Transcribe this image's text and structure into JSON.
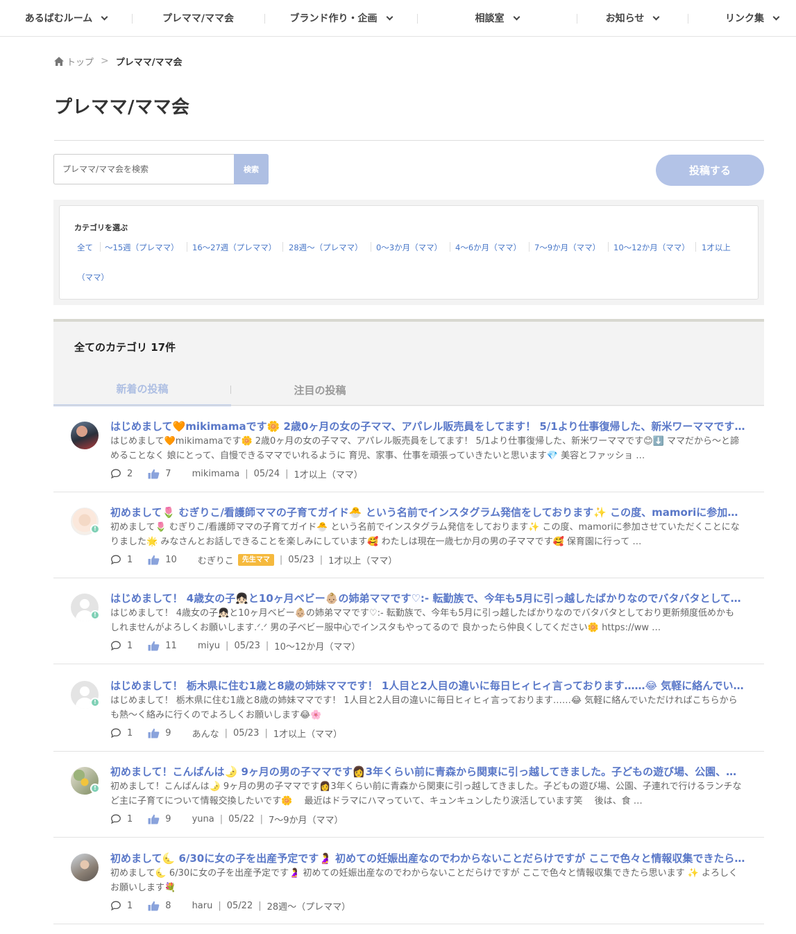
{
  "nav": [
    {
      "label": "あるばむルーム",
      "dropdown": true
    },
    {
      "label": "プレママ/ママ会",
      "dropdown": false
    },
    {
      "label": "ブランド作り・企画",
      "dropdown": true
    },
    {
      "label": "相談室",
      "dropdown": true
    },
    {
      "label": "お知らせ",
      "dropdown": true
    },
    {
      "label": "リンク集",
      "dropdown": true
    }
  ],
  "breadcrumb": {
    "home": "トップ",
    "separator": ">",
    "current": "プレママ/ママ会"
  },
  "page_title": "プレママ/ママ会",
  "search": {
    "placeholder": "プレママ/ママ会を検索",
    "button": "検索"
  },
  "post_button": "投稿する",
  "categories": {
    "heading": "カテゴリを選ぶ",
    "items": [
      "全て",
      "〜15週（プレママ）",
      "16〜27週（プレママ）",
      "28週〜（プレママ）",
      "0〜3か月（ママ）",
      "4〜6か月（ママ）",
      "7〜9か月（ママ）",
      "10〜12か月（ママ）",
      "1才以上",
      "（ママ）"
    ]
  },
  "count_label": "全てのカテゴリ 17件",
  "tabs": {
    "new": "新着の投稿",
    "hot": "注目の投稿"
  },
  "posts": [
    {
      "title": "はじめまして🧡mikimamaです🌼 2歳0ヶ月の女の子ママ、アパレル販売員をしてます！ 5/1より仕事復帰した、新米ワーママです😊⬇️ ママだから〜と諦めることなく",
      "body": "はじめまして🧡mikimamaです🌼 2歳0ヶ月の女の子ママ、アパレル販売員をしてます！ 5/1より仕事復帰した、新米ワーママです😊⬇️ ママだから〜と諦めることなく 娘にとって、自慢できるママでいれるように 育児、家事、仕事を頑張っていきたいと思います💎 美容とファッショ …",
      "comments": "2",
      "likes": "7",
      "user": "mikimama",
      "tag": "",
      "date": "05/24",
      "category": "1才以上（ママ）",
      "avatar": "photo1",
      "badge": false
    },
    {
      "title": "初めまして🌷 むぎりこ/看護師ママの子育てガイド🐣 という名前でインスタグラム発信をしております✨ この度、mamoriに参加させていただくことになりました",
      "body": "初めまして🌷 むぎりこ/看護師ママの子育てガイド🐣 という名前でインスタグラム発信をしております✨ この度、mamoriに参加させていただくことになりました🌟 みなさんとお話しできることを楽しみにしています🥰 わたしは現在一歳七か月の男の子ママです🥰 保育園に行って …",
      "comments": "1",
      "likes": "10",
      "user": "むぎりこ",
      "tag": "先生ママ",
      "date": "05/23",
      "category": "1才以上（ママ）",
      "avatar": "illust",
      "badge": true
    },
    {
      "title": "はじめまして！ 4歳女の子👧🏻と10ヶ月ベビー👶🏼の姉弟ママです♡:- 転勤族で、今年も5月に引っ越したばかりなのでバタバタとしており更新頻度低め",
      "body": "はじめまして！ 4歳女の子👧🏻と10ヶ月ベビー👶🏼の姉弟ママです♡:- 転勤族で、今年も5月に引っ越したばかりなのでバタバタとしており更新頻度低めかもしれませんがよろしくお願いします.ᐟ.ᐟ 男の子ベビー服中心でインスタもやってるので 良かったら仲良くしてください🌼 https://ww …",
      "comments": "1",
      "likes": "11",
      "user": "miyu",
      "tag": "",
      "date": "05/23",
      "category": "10〜12か月（ママ）",
      "avatar": "default",
      "badge": true
    },
    {
      "title": "はじめまして！ 栃木県に住む1歳と8歳の姉妹ママです！ 1人目と2人目の違いに毎日ヒィヒィ言っております……😂 気軽に絡んでいただければ",
      "body": "はじめまして！ 栃木県に住む1歳と8歳の姉妹ママです！ 1人目と2人目の違いに毎日ヒィヒィ言っております……😂 気軽に絡んでいただければこちらからも熱〜く絡みに行くのでよろしくお願いします😂🌸",
      "comments": "1",
      "likes": "9",
      "user": "あんな",
      "tag": "",
      "date": "05/23",
      "category": "1才以上（ママ）",
      "avatar": "default",
      "badge": true
    },
    {
      "title": "初めまして！こんばんは🌛 9ヶ月の男の子ママです👩3年くらい前に青森から関東に引っ越してきました。子どもの遊び場、公園、子連れで行けるランチなど",
      "body": "初めまして！こんばんは🌛 9ヶ月の男の子ママです👩3年くらい前に青森から関東に引っ越してきました。子どもの遊び場、公園、子連れで行けるランチなど主に子育てについて情報交換したいです🌼　 最近はドラマにハマっていて、キュンキュンしたり涙活しています笑　 後は、食 …",
      "comments": "1",
      "likes": "9",
      "user": "yuna",
      "tag": "",
      "date": "05/22",
      "category": "7〜9か月（ママ）",
      "avatar": "photo2",
      "badge": true
    },
    {
      "title": "初めまして🌜 6/30に女の子を出産予定です🤰 初めての妊娠出産なのでわからないことだらけですが ここで色々と情報収集できたら思います",
      "body": "初めまして🌜 6/30に女の子を出産予定です🤰 初めての妊娠出産なのでわからないことだらけですが ここで色々と情報収集できたら思います ✨ よろしくお願いします💐",
      "comments": "1",
      "likes": "8",
      "user": "haru",
      "tag": "",
      "date": "05/22",
      "category": "28週〜（プレママ）",
      "avatar": "photo3",
      "badge": false
    }
  ],
  "colors": {
    "accent": "#5a78c8",
    "link": "#4a78c8",
    "button": "#b3c3e7",
    "tag": "#f5b93d",
    "badge": "#7fd0b5"
  },
  "icons": {
    "home": "home-icon",
    "comment": "comment-icon",
    "like": "thumbs-up-icon",
    "dropdown": "chevron-down-icon"
  }
}
